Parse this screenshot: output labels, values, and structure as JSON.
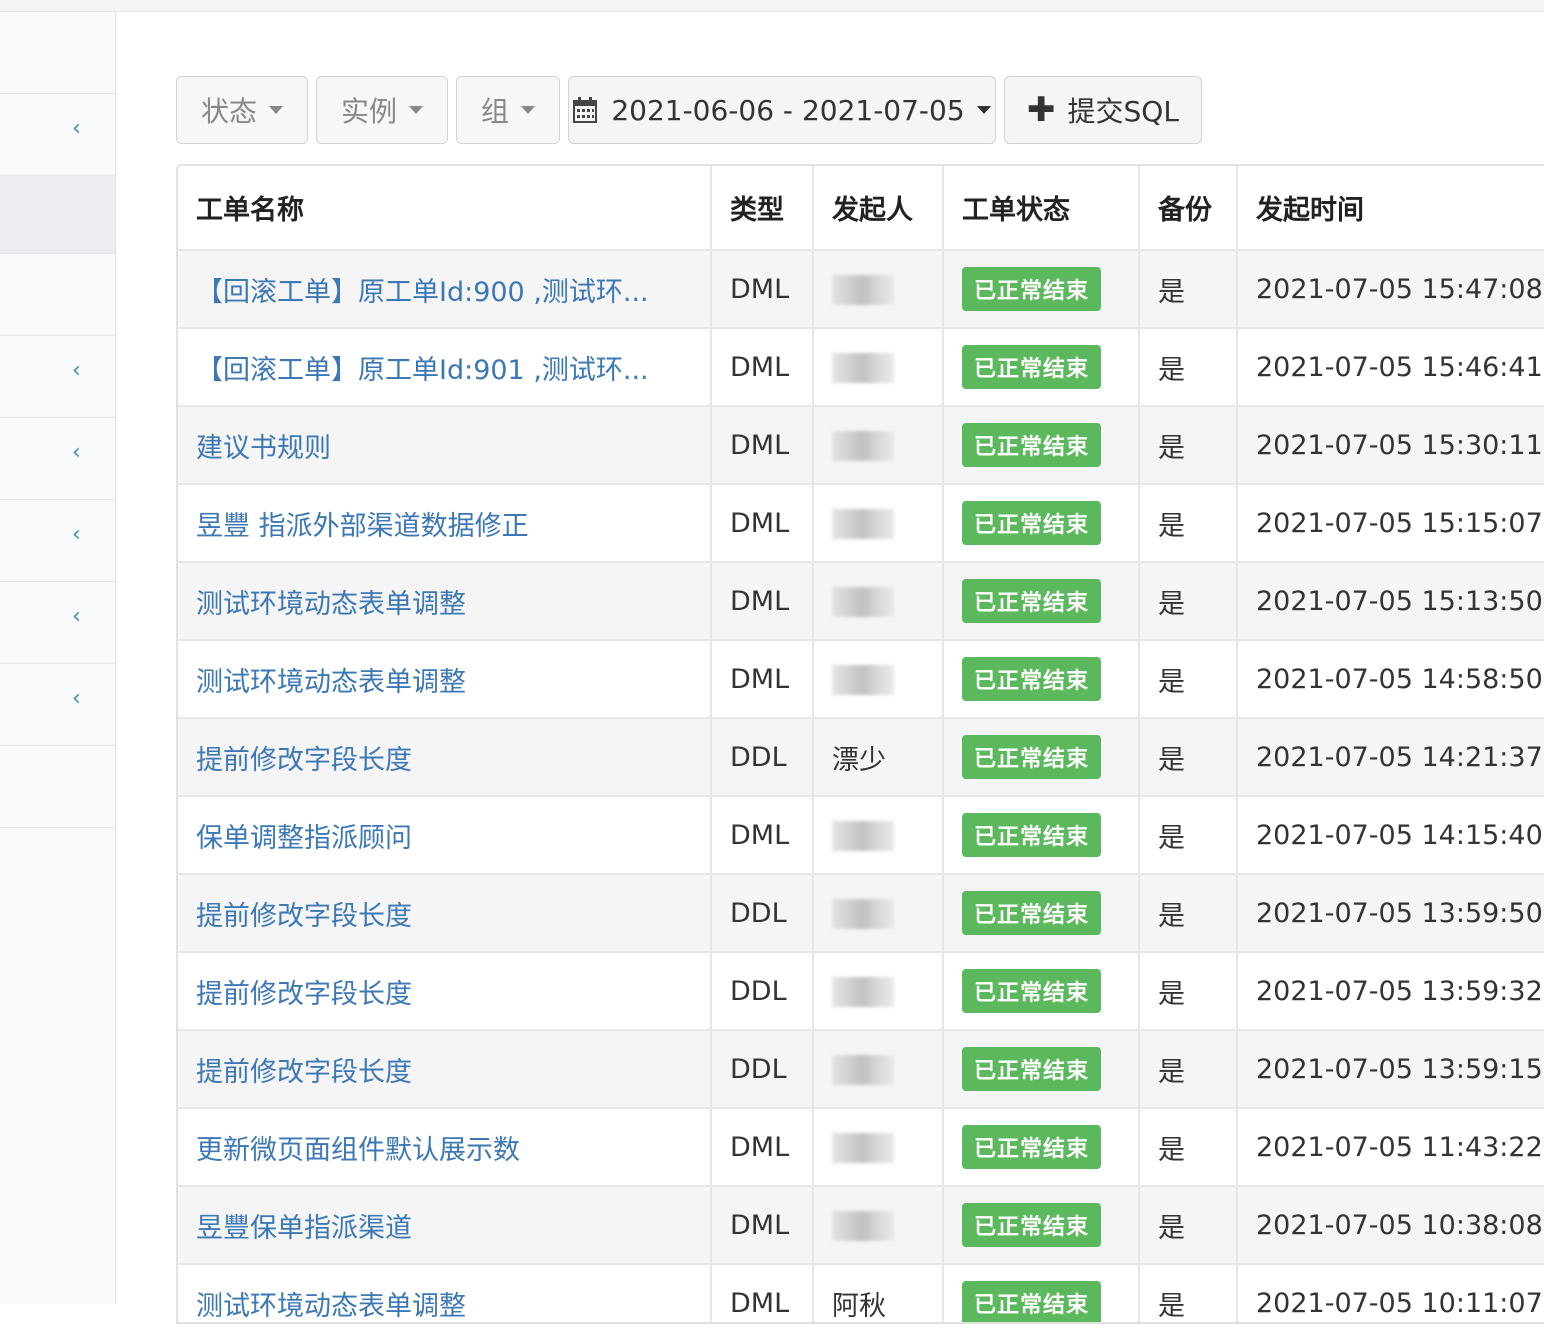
{
  "toolbar": {
    "status_label": "状态",
    "instance_label": "实例",
    "group_label": "组",
    "date_range": "2021-06-06 - 2021-07-05",
    "submit_label": "提交SQL"
  },
  "table": {
    "headers": [
      "工单名称",
      "类型",
      "发起人",
      "工单状态",
      "备份",
      "发起时间"
    ],
    "rows": [
      {
        "name": "【回滚工单】原工单Id:900 ,测试环...",
        "type": "DML",
        "initiator": "",
        "status": "已正常结束",
        "backup": "是",
        "time": "2021-07-05 15:47:08"
      },
      {
        "name": "【回滚工单】原工单Id:901 ,测试环...",
        "type": "DML",
        "initiator": "",
        "status": "已正常结束",
        "backup": "是",
        "time": "2021-07-05 15:46:41"
      },
      {
        "name": "建议书规则",
        "type": "DML",
        "initiator": "",
        "status": "已正常结束",
        "backup": "是",
        "time": "2021-07-05 15:30:11"
      },
      {
        "name": "昱豐 指派外部渠道数据修正",
        "type": "DML",
        "initiator": "",
        "status": "已正常结束",
        "backup": "是",
        "time": "2021-07-05 15:15:07"
      },
      {
        "name": "测试环境动态表单调整",
        "type": "DML",
        "initiator": "",
        "status": "已正常结束",
        "backup": "是",
        "time": "2021-07-05 15:13:50"
      },
      {
        "name": "测试环境动态表单调整",
        "type": "DML",
        "initiator": "",
        "status": "已正常结束",
        "backup": "是",
        "time": "2021-07-05 14:58:50"
      },
      {
        "name": "提前修改字段长度",
        "type": "DDL",
        "initiator": "漂少",
        "status": "已正常结束",
        "backup": "是",
        "time": "2021-07-05 14:21:37"
      },
      {
        "name": "保单调整指派顾问",
        "type": "DML",
        "initiator": "",
        "status": "已正常结束",
        "backup": "是",
        "time": "2021-07-05 14:15:40"
      },
      {
        "name": "提前修改字段长度",
        "type": "DDL",
        "initiator": "",
        "status": "已正常结束",
        "backup": "是",
        "time": "2021-07-05 13:59:50"
      },
      {
        "name": "提前修改字段长度",
        "type": "DDL",
        "initiator": "",
        "status": "已正常结束",
        "backup": "是",
        "time": "2021-07-05 13:59:32"
      },
      {
        "name": "提前修改字段长度",
        "type": "DDL",
        "initiator": "",
        "status": "已正常结束",
        "backup": "是",
        "time": "2021-07-05 13:59:15"
      },
      {
        "name": "更新微页面组件默认展示数",
        "type": "DML",
        "initiator": "",
        "status": "已正常结束",
        "backup": "是",
        "time": "2021-07-05 11:43:22"
      },
      {
        "name": "昱豐保单指派渠道",
        "type": "DML",
        "initiator": "",
        "status": "已正常结束",
        "backup": "是",
        "time": "2021-07-05 10:38:08"
      },
      {
        "name": "测试环境动态表单调整",
        "type": "DML",
        "initiator": "阿秋",
        "status": "已正常结束",
        "backup": "是",
        "time": "2021-07-05 10:11:07"
      }
    ]
  },
  "colors": {
    "link": "#3c78b5",
    "badge": "#5cb85c",
    "sidebar_accent": "#3c8dbc"
  }
}
